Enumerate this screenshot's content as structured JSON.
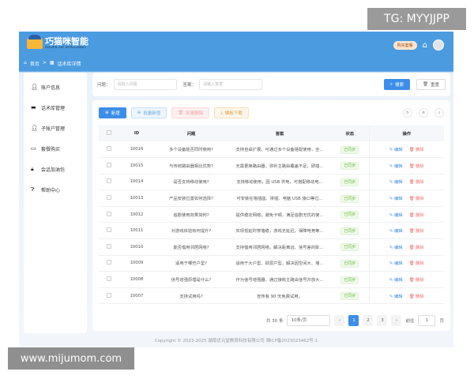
{
  "header": {
    "logo_title": "巧猫咪智能",
    "logo_subtitle": "CLEVER CAT INTELLIGENT",
    "buy_label": "购买套餐"
  },
  "breadcrumb": {
    "home": "首页",
    "sep": ">",
    "current": "话术库详情"
  },
  "sidebar": {
    "items": [
      {
        "label": "账户信息",
        "icon": "user-icon"
      },
      {
        "label": "话术库管理",
        "icon": "monitor-icon"
      },
      {
        "label": "子账户管理",
        "icon": "user-icon"
      },
      {
        "label": "套餐购买",
        "icon": "card-icon"
      },
      {
        "label": "会话加油包",
        "icon": "bag-icon"
      },
      {
        "label": "帮助中心",
        "icon": "help-icon"
      }
    ]
  },
  "search": {
    "question_label": "问题：",
    "question_placeholder": "请输入问题",
    "answer_label": "答案：",
    "answer_placeholder": "请输入答案",
    "search_label": "搜索",
    "reset_label": "重置"
  },
  "toolbar": {
    "add": "新增",
    "batch_add": "批量新增",
    "batch_delete": "批量删除",
    "template_download": "模板下载"
  },
  "table": {
    "columns": [
      "ID",
      "问题",
      "答案",
      "状态",
      "操作"
    ],
    "edit_label": "编辑",
    "delete_label": "删除",
    "rows": [
      {
        "id": "10016",
        "q": "多个设备能否同时使用?",
        "a": "支持自由扩展，可通过多个设备搭配使用，全...",
        "status": "已同步"
      },
      {
        "id": "10015",
        "q": "与传统路由器相比优势?",
        "a": "无需更换路由器，弥补主路由覆盖不足，即插...",
        "status": "已同步"
      },
      {
        "id": "10014",
        "q": "是否支持移动使用?",
        "a": "支持移动使用，因 USB 供电，可搭配移动电...",
        "status": "已同步"
      },
      {
        "id": "10013",
        "q": "产品安装位置如何选择?",
        "a": "可安装在墙插座、排插、电脑 USB 接口等位...",
        "status": "已同步"
      },
      {
        "id": "10012",
        "q": "追剧使用效果如何?",
        "a": "提供稳定网络，避免卡顿，满足追剧无忧的使...",
        "status": "已同步"
      },
      {
        "id": "10011",
        "q": "对游戏体验有何提升?",
        "a": "实现低延时穿墙稳，游戏无延迟，保障电竞等...",
        "status": "已同步"
      },
      {
        "id": "10010",
        "q": "能否借用邻居网络?",
        "a": "支持借用邻居网络，解决距离远、信号差的耿...",
        "status": "已同步"
      },
      {
        "id": "10009",
        "q": "适用于哪些户型?",
        "a": "适用于大户型、跃层户型，解决因空间大、墙...",
        "status": "已同步"
      },
      {
        "id": "10008",
        "q": "信号增强原理是什么?",
        "a": "作为信号增强器，通过接收主路由信号并放大...",
        "status": "已同步"
      },
      {
        "id": "10007",
        "q": "支持试用吗?",
        "a": "宣传有 90 天免费试用。",
        "status": "已同步"
      }
    ]
  },
  "pagination": {
    "total": "共 30 条",
    "page_size": "10条/页",
    "pages": [
      "1",
      "2",
      "3"
    ],
    "current": "1",
    "goto_label": "前往",
    "goto_value": "1",
    "page_unit": "页"
  },
  "footer": {
    "copyright": "Copyright © 2023-2025 湖南优元堂教育科技有限公司 湘ICP备2023023462号-1"
  },
  "watermarks": {
    "top": "TG: MYYJJPP",
    "bottom": "www.mijumom.com"
  }
}
